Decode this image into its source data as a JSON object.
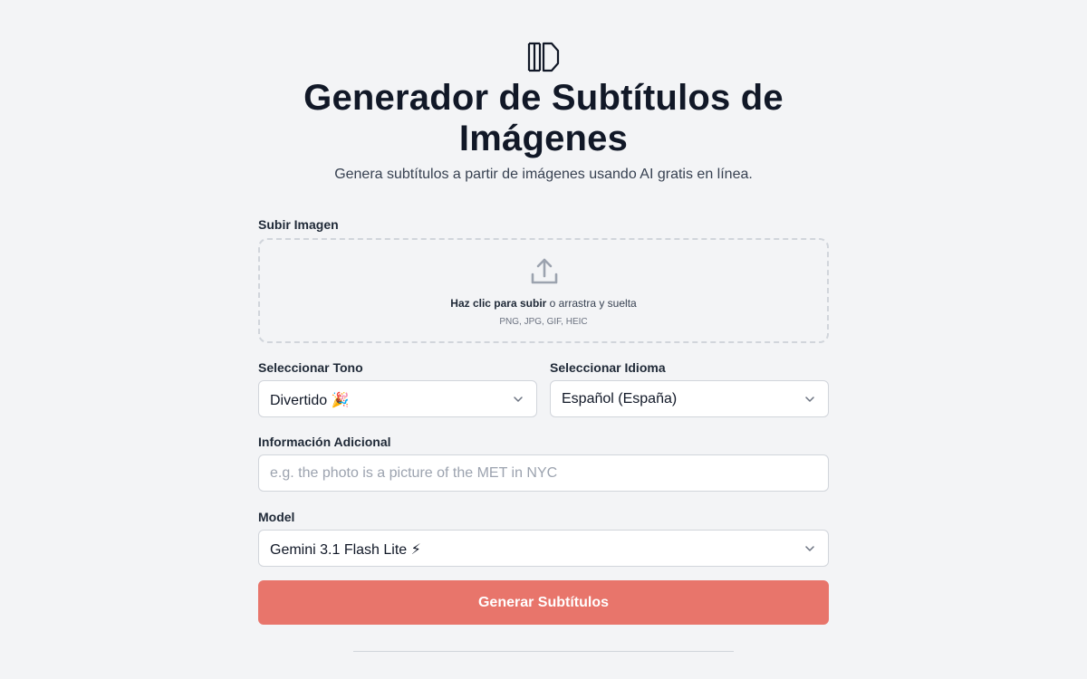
{
  "header": {
    "title_line1": "Generador de Subtítulos de",
    "title_line2": "Imágenes",
    "subtitle": "Genera subtítulos a partir de imágenes usando AI gratis en línea."
  },
  "upload": {
    "label": "Subir Imagen",
    "cta_bold": "Haz clic para subir",
    "cta_rest": " o arrastra y suelta",
    "formats": "PNG, JPG, GIF, HEIC"
  },
  "tone": {
    "label": "Seleccionar Tono",
    "selected": "Divertido 🎉"
  },
  "language": {
    "label": "Seleccionar Idioma",
    "selected": "Español (España)"
  },
  "additional": {
    "label": "Información Adicional",
    "placeholder": "e.g. the photo is a picture of the MET in NYC",
    "value": ""
  },
  "model": {
    "label": "Model",
    "selected": "Gemini 3.1 Flash Lite ⚡"
  },
  "submit": {
    "label": "Generar Subtítulos"
  },
  "colors": {
    "accent": "#e8756b",
    "background": "#f3f4f6"
  }
}
